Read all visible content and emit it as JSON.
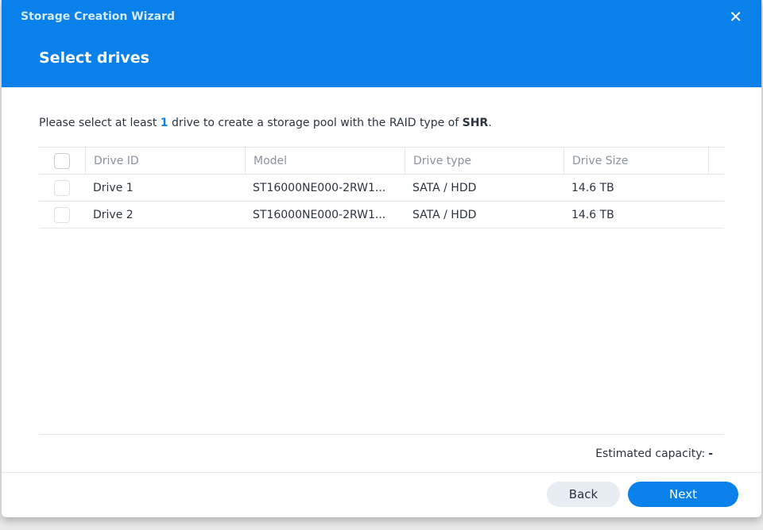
{
  "window": {
    "title": "Storage Creation Wizard",
    "close_icon": "close-icon"
  },
  "step": {
    "title": "Select drives"
  },
  "instruction": {
    "prefix": "Please select at least ",
    "count": "1",
    "middle": " drive to create a storage pool with the RAID type of ",
    "raid": "SHR",
    "suffix": "."
  },
  "table": {
    "headers": [
      "Drive ID",
      "Model",
      "Drive type",
      "Drive Size"
    ],
    "rows": [
      {
        "id": "Drive 1",
        "model": "ST16000NE000-2RW1...",
        "type": "SATA / HDD",
        "size": "14.6 TB",
        "checked": false
      },
      {
        "id": "Drive 2",
        "model": "ST16000NE000-2RW1...",
        "type": "SATA / HDD",
        "size": "14.6 TB",
        "checked": false
      }
    ]
  },
  "capacity": {
    "label": "Estimated capacity:",
    "value": "-"
  },
  "footer": {
    "back": "Back",
    "next": "Next"
  },
  "colors": {
    "accent": "#0a80ea"
  }
}
